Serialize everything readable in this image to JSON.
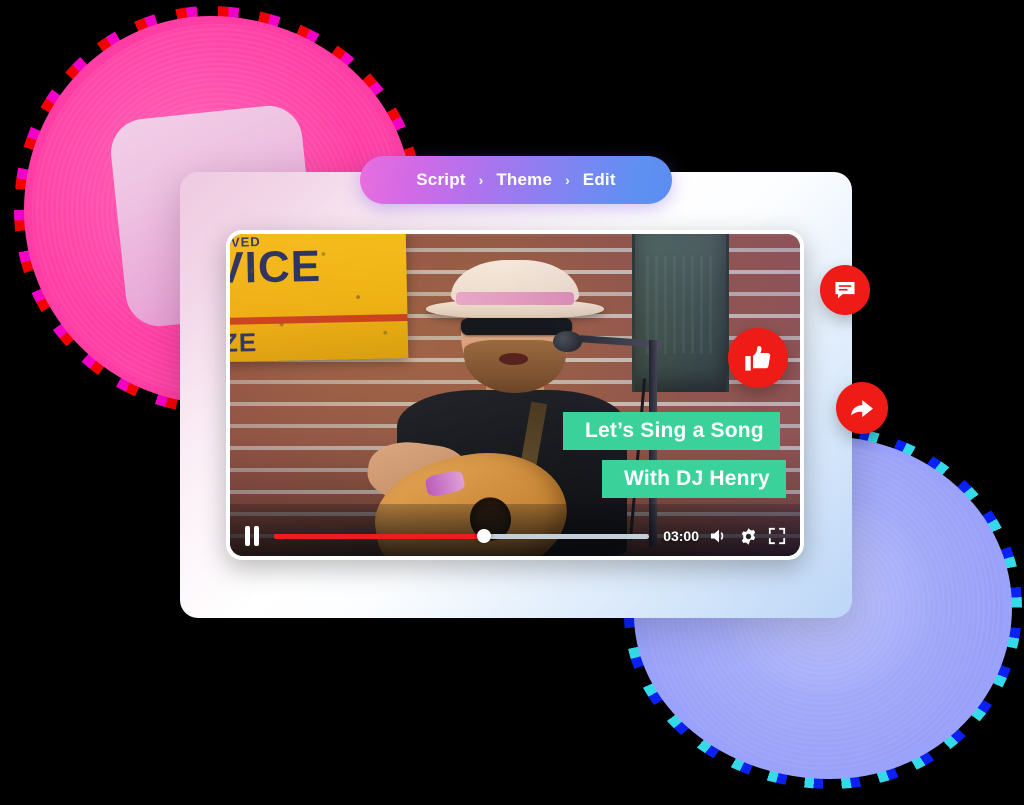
{
  "breadcrumb": {
    "items": [
      {
        "label": "Script"
      },
      {
        "label": "Theme"
      },
      {
        "label": "Edit"
      }
    ],
    "separator": "›",
    "gradient_from": "#e86ede",
    "gradient_to": "#5c8ef1"
  },
  "player": {
    "controls": {
      "pause_label": "Pause",
      "time": "03:00",
      "progress_percent": 56,
      "volume_label": "Volume",
      "settings_label": "Settings",
      "fullscreen_label": "Fullscreen",
      "progress_fill_color": "#ef1c1c",
      "progress_track_color": "#c3cfdb"
    },
    "captions": [
      {
        "text": "Let’s Sing a Song"
      },
      {
        "text": "With DJ Henry"
      }
    ],
    "caption_bg": "#3ad29a",
    "scene": {
      "sign_line1": "OVED",
      "sign_line2": "VICE",
      "sign_line3": "ZE"
    }
  },
  "actions": [
    {
      "name": "comment",
      "color": "#ee1b16"
    },
    {
      "name": "like",
      "color": "#ee1b16"
    },
    {
      "name": "share",
      "color": "#ee1b16"
    }
  ],
  "decor": {
    "pink_blob_color": "#ff3ea5",
    "blue_blob_color": "#9da4f8",
    "card_gradient_from": "#efc9e0",
    "card_gradient_to": "#bcd6f7"
  }
}
